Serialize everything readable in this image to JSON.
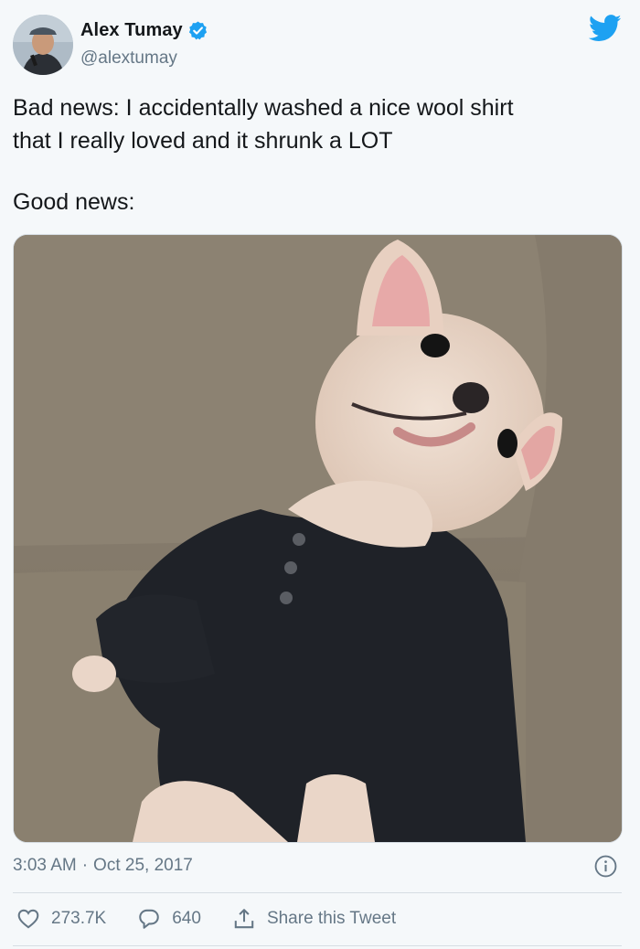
{
  "user": {
    "display_name": "Alex Tumay",
    "handle": "@alextumay",
    "verified": true,
    "avatar_icon": "avatar-photo"
  },
  "tweet": {
    "lines": [
      "Bad news: I accidentally washed a nice wool shirt",
      "that I really loved and it shrunk a LOT",
      "Good news:"
    ],
    "media_alt": "French bulldog wearing a small dark wool shirt on a couch"
  },
  "meta": {
    "time": "3:03 AM",
    "separator": "·",
    "date": "Oct 25, 2017"
  },
  "actions": {
    "likes": "273.7K",
    "replies": "640",
    "share_label": "Share this Tweet"
  },
  "colors": {
    "twitter_blue": "#1da1f2",
    "secondary_text": "#657786",
    "background": "#f5f8fa"
  },
  "icons": [
    "twitter-bird-icon",
    "verified-badge-icon",
    "info-icon",
    "heart-icon",
    "reply-icon",
    "share-icon"
  ]
}
